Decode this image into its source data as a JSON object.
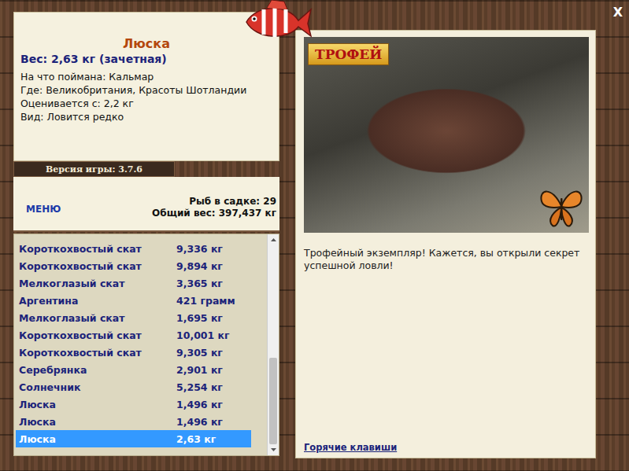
{
  "close": "X",
  "fish_info": {
    "title": "Люска",
    "weight": "Вес: 2,63 кг (зачетная)",
    "details": [
      "На что поймана: Кальмар",
      "Где: Великобритания, Красоты Шотландии",
      "Оценивается с: 2,2 кг",
      "Вид: Ловится редко"
    ]
  },
  "version": "Версия игры: 3.7.6",
  "menu": "МЕНЮ",
  "stats": [
    "Рыб в садке: 29",
    "Общий вес: 397,437 кг"
  ],
  "catch_list": [
    {
      "name": "Короткохвостый скат",
      "weight": "9,336 кг",
      "selected": false
    },
    {
      "name": "Короткохвостый скат",
      "weight": "9,894 кг",
      "selected": false
    },
    {
      "name": "Мелкоглазый скат",
      "weight": "3,365 кг",
      "selected": false
    },
    {
      "name": "Аргентина",
      "weight": "421 грамм",
      "selected": false
    },
    {
      "name": "Мелкоглазый скат",
      "weight": "1,695 кг",
      "selected": false
    },
    {
      "name": "Короткохвостый скат",
      "weight": "10,001 кг",
      "selected": false
    },
    {
      "name": "Короткохвостый скат",
      "weight": "9,305 кг",
      "selected": false
    },
    {
      "name": "Серебрянка",
      "weight": "2,901 кг",
      "selected": false
    },
    {
      "name": "Солнечник",
      "weight": "5,254 кг",
      "selected": false
    },
    {
      "name": "Люска",
      "weight": "1,496 кг",
      "selected": false
    },
    {
      "name": "Люска",
      "weight": "1,496 кг",
      "selected": false
    },
    {
      "name": "Люска",
      "weight": "2,63 кг",
      "selected": true
    }
  ],
  "scroll": {
    "level": 1
  },
  "trophy": {
    "badge": "ТРОФЕЙ",
    "message": "Трофейный экземпляр! Кажется, вы открыли секрет успешной ловли!"
  },
  "hotkeys": "Горячие клавиши"
}
